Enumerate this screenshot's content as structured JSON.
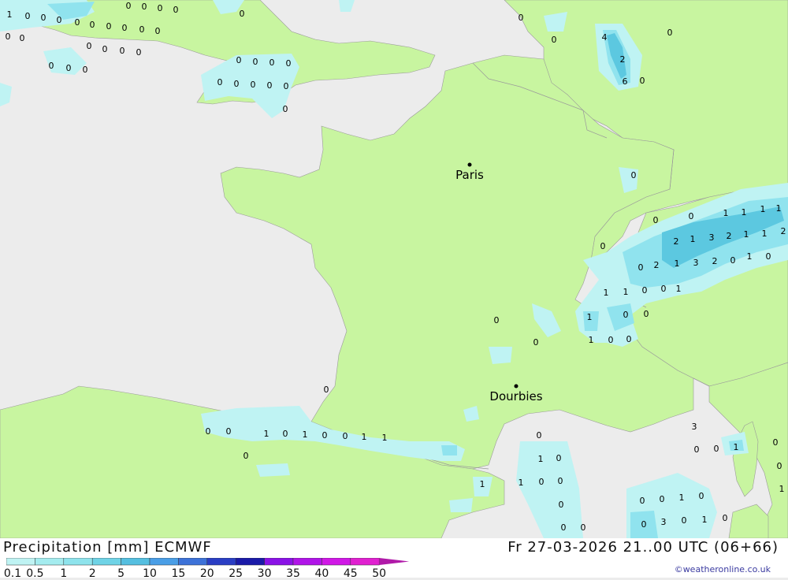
{
  "map": {
    "cities": [
      {
        "name": "Paris"
      },
      {
        "name": "Dourbies"
      }
    ],
    "labels": [
      "1",
      "0",
      "0",
      "0",
      "0",
      "0",
      "0",
      "0",
      "0",
      "0",
      "0",
      "0",
      "0",
      "0",
      "0",
      "0",
      "0",
      "0",
      "0",
      "0",
      "0",
      "0",
      "0",
      "0",
      "0",
      "0",
      "0",
      "0",
      "0",
      "0",
      "0",
      "0",
      "0",
      "0",
      "0",
      "4",
      "2",
      "6",
      "0",
      "0",
      "0",
      "0",
      "0",
      "0",
      "1",
      "1",
      "1",
      "1",
      "2",
      "1",
      "3",
      "2",
      "1",
      "1",
      "2",
      "2",
      "1",
      "3",
      "2",
      "0",
      "1",
      "0",
      "0",
      "0",
      "1",
      "1",
      "0",
      "0",
      "1",
      "1",
      "0",
      "0",
      "1",
      "0",
      "0",
      "0",
      "0",
      "0",
      "0",
      "0",
      "1",
      "0",
      "1",
      "0",
      "0",
      "1",
      "1",
      "0",
      "0",
      "1",
      "0",
      "1",
      "0",
      "0",
      "1",
      "0",
      "0",
      "0",
      "3",
      "0",
      "0",
      "1",
      "0",
      "0",
      "1",
      "0",
      "0",
      "1",
      "0",
      "0",
      "3",
      "0",
      "1",
      "0",
      "0"
    ],
    "colors": {
      "sea": "#ececec",
      "land": "#c8f5a0",
      "precip_light": "#bff3f3",
      "precip_mid": "#90e3ee",
      "precip_heavy": "#5cc8e0",
      "border": "#9a9a9a"
    }
  },
  "footer": {
    "title": "Precipitation [mm] ECMWF",
    "date": "Fr 27-03-2026 21..00 UTC (06+66)",
    "credit": "©weatheronline.co.uk"
  },
  "legend": {
    "labels": [
      "0.1",
      "0.5",
      "1",
      "2",
      "5",
      "10",
      "15",
      "20",
      "25",
      "30",
      "35",
      "40",
      "45",
      "50"
    ],
    "colors": [
      "#bff3f3",
      "#a4ecef",
      "#8ee3ec",
      "#6fd3e6",
      "#55bfe0",
      "#4a9ee6",
      "#3d72d8",
      "#2a3ec4",
      "#1a1aa8",
      "#8a12e6",
      "#b014e8",
      "#d018e6",
      "#e020d0",
      "#b01aa8"
    ]
  }
}
